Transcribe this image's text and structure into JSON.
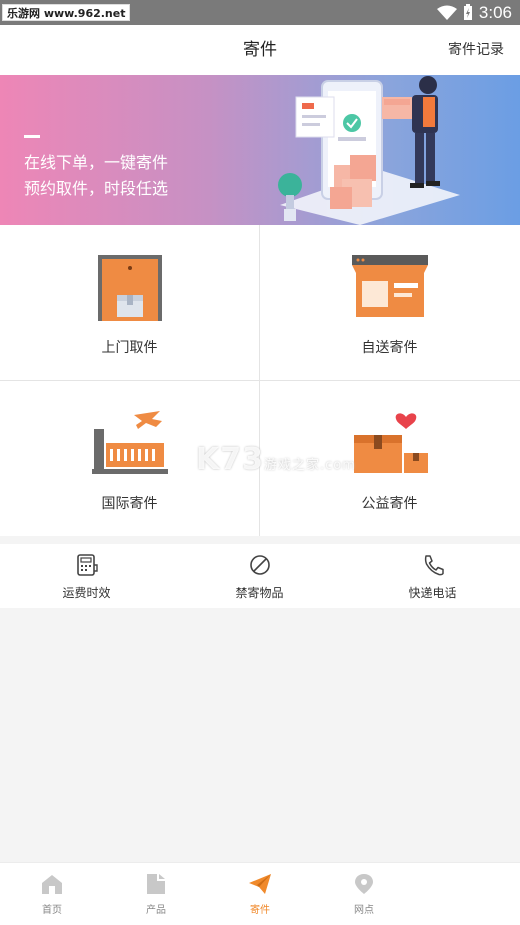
{
  "status_bar": {
    "watermark": "乐游网 www.962.net",
    "time": "3:06"
  },
  "header": {
    "title": "寄件",
    "records_link": "寄件记录"
  },
  "banner": {
    "line1": "在线下单，一键寄件",
    "line2": "预约取件，时段任选"
  },
  "services": [
    {
      "label": "上门取件",
      "icon": "door-pickup-icon"
    },
    {
      "label": "自送寄件",
      "icon": "storefront-icon"
    },
    {
      "label": "国际寄件",
      "icon": "airplane-shipping-icon"
    },
    {
      "label": "公益寄件",
      "icon": "charity-box-icon"
    }
  ],
  "watermark": {
    "main": "K73",
    "sub": "游戏之家",
    "domain": ".com"
  },
  "tools": [
    {
      "label": "运费时效",
      "icon": "calculator-icon"
    },
    {
      "label": "禁寄物品",
      "icon": "prohibited-icon"
    },
    {
      "label": "快递电话",
      "icon": "phone-icon"
    }
  ],
  "tabbar": {
    "active": "寄件",
    "items": [
      {
        "label": "首页",
        "icon": "home-icon"
      },
      {
        "label": "产品",
        "icon": "product-icon"
      },
      {
        "label": "寄件",
        "icon": "paper-plane-icon"
      },
      {
        "label": "网点",
        "icon": "location-pin-icon"
      }
    ]
  },
  "colors": {
    "accent": "#f08a2c",
    "banner_start": "#ee86b6",
    "banner_end": "#6b9ee4"
  }
}
